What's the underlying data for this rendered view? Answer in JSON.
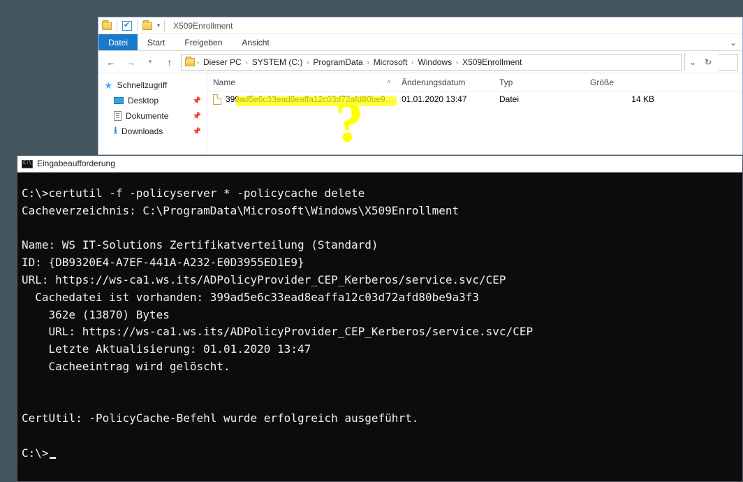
{
  "explorer": {
    "title": "X509Enrollment",
    "tabs": {
      "file": "Datei",
      "start": "Start",
      "share": "Freigeben",
      "view": "Ansicht"
    },
    "breadcrumbs": [
      "Dieser PC",
      "SYSTEM (C:)",
      "ProgramData",
      "Microsoft",
      "Windows",
      "X509Enrollment"
    ],
    "columns": {
      "name": "Name",
      "date": "Änderungsdatum",
      "type": "Typ",
      "size": "Größe"
    },
    "navpane": {
      "quick": "Schnellzugriff",
      "desktop": "Desktop",
      "documents": "Dokumente",
      "downloads": "Downloads"
    },
    "file": {
      "name": "399ad5e6c33ead8eaffa12c03d72afd80be9…",
      "date": "01.01.2020 13:47",
      "type": "Datei",
      "size": "14 KB"
    }
  },
  "cmd": {
    "title": "Eingabeaufforderung",
    "lines": [
      "C:\\>certutil -f -policyserver * -policycache delete",
      "Cacheverzeichnis: C:\\ProgramData\\Microsoft\\Windows\\X509Enrollment",
      "",
      "Name: WS IT-Solutions Zertifikatverteilung (Standard)",
      "ID: {DB9320E4-A7EF-441A-A232-E0D3955ED1E9}",
      "URL: https://ws-ca1.ws.its/ADPolicyProvider_CEP_Kerberos/service.svc/CEP",
      "  Cachedatei ist vorhanden: 399ad5e6c33ead8eaffa12c03d72afd80be9a3f3",
      "    362e (13870) Bytes",
      "    URL: https://ws-ca1.ws.its/ADPolicyProvider_CEP_Kerberos/service.svc/CEP",
      "    Letzte Aktualisierung: 01.01.2020 13:47",
      "    Cacheeintrag wird gelöscht.",
      "",
      "",
      "CertUtil: -PolicyCache-Befehl wurde erfolgreich ausgeführt.",
      "",
      "C:\\>"
    ]
  }
}
